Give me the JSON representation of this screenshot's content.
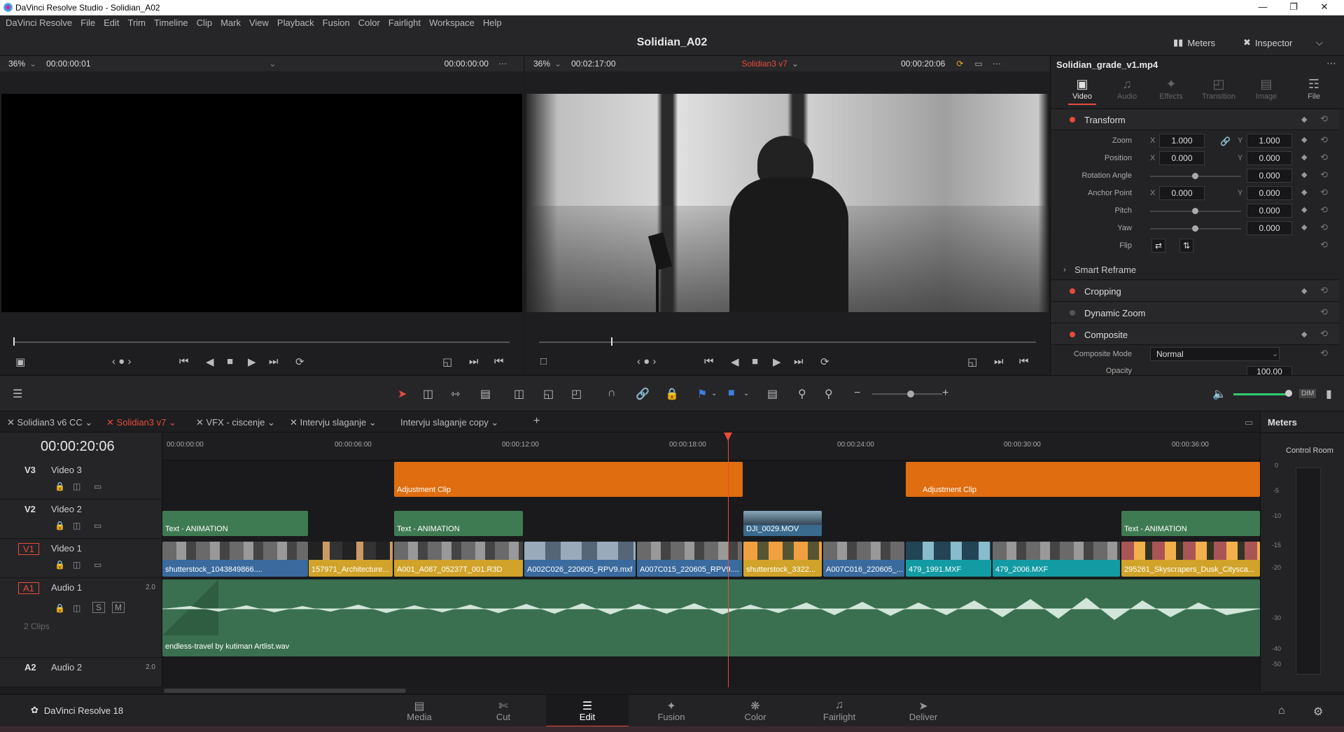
{
  "window": {
    "title": "DaVinci Resolve Studio - Solidian_A02"
  },
  "menu": [
    "DaVinci Resolve",
    "File",
    "Edit",
    "Trim",
    "Timeline",
    "Clip",
    "Mark",
    "View",
    "Playback",
    "Fusion",
    "Color",
    "Fairlight",
    "Workspace",
    "Help"
  ],
  "header": {
    "project": "Solidian_A02",
    "meters": "Meters",
    "inspector": "Inspector"
  },
  "source_viewer": {
    "zoom": "36%",
    "timecode_left": "00:00:00:01",
    "timecode_right": "00:00:00:00"
  },
  "timeline_viewer": {
    "zoom": "36%",
    "duration": "00:02:17:00",
    "timeline_name": "Solidian3 v7",
    "timecode": "00:00:20:06"
  },
  "inspector": {
    "clip_name": "Solidian_grade_v1.mp4",
    "tabs": [
      "Video",
      "Audio",
      "Effects",
      "Transition",
      "Image",
      "File"
    ],
    "sections": {
      "transform": "Transform",
      "smart_reframe": "Smart Reframe",
      "cropping": "Cropping",
      "dynamic_zoom": "Dynamic Zoom",
      "composite": "Composite"
    },
    "params": {
      "zoom_label": "Zoom",
      "zoom_x": "1.000",
      "zoom_y": "1.000",
      "position_label": "Position",
      "position_x": "0.000",
      "position_y": "0.000",
      "rotation_label": "Rotation Angle",
      "rotation": "0.000",
      "anchor_label": "Anchor Point",
      "anchor_x": "0.000",
      "anchor_y": "0.000",
      "pitch_label": "Pitch",
      "pitch": "0.000",
      "yaw_label": "Yaw",
      "yaw": "0.000",
      "flip_label": "Flip",
      "composite_mode_label": "Composite Mode",
      "composite_mode": "Normal",
      "opacity_label": "Opacity",
      "opacity": "100.00",
      "x": "X",
      "y": "Y"
    }
  },
  "timeline_tabs": [
    "Solidian3 v6 CC",
    "Solidian3 v7",
    "VFX - ciscenje",
    "Intervju slaganje",
    "Intervju slaganje copy"
  ],
  "timeline": {
    "timecode": "00:00:20:06",
    "ruler": [
      "00:00:00:00",
      "00:00:06:00",
      "00:00:12:00",
      "00:00:18:00",
      "00:00:24:00",
      "00:00:30:00",
      "00:00:36:00"
    ],
    "tracks": {
      "v3": {
        "id": "V3",
        "name": "Video 3"
      },
      "v2": {
        "id": "V2",
        "name": "Video 2"
      },
      "v1": {
        "id": "V1",
        "name": "Video 1"
      },
      "a1": {
        "id": "A1",
        "name": "Audio 1",
        "ch": "2.0",
        "clips": "2 Clips",
        "s": "S",
        "m": "M"
      },
      "a2": {
        "id": "A2",
        "name": "Audio 2",
        "ch": "2.0"
      }
    },
    "clips": {
      "adj1": "Adjustment Clip",
      "adj2": "Adjustment Clip",
      "text1": "Text - ANIMATION",
      "text2": "Text - ANIMATION",
      "text3": "Text - ANIMATION",
      "dji": "DJI_0029.MOV",
      "v1": [
        "shutterstock_1043849866....",
        "157971_Architecture...",
        "A001_A087_05237T_001.R3D",
        "A002C026_220605_RPV9.mxf",
        "A007C015_220605_RPV9....",
        "shutterstock_3322...",
        "A007C016_220605_...",
        "479_1991.MXF",
        "479_2006.MXF",
        "295261_Skyscrapers_Dusk_Citysca..."
      ],
      "audio": "endless-travel by kutiman Artlist.wav"
    }
  },
  "meters_panel": {
    "title": "Meters",
    "room": "Control Room",
    "scale": [
      "0",
      "-5",
      "-10",
      "-15",
      "-20",
      "-30",
      "-40",
      "-50"
    ]
  },
  "pages": [
    "Media",
    "Cut",
    "Edit",
    "Fusion",
    "Color",
    "Fairlight",
    "Deliver"
  ],
  "app": {
    "name": "DaVinci Resolve 18"
  }
}
